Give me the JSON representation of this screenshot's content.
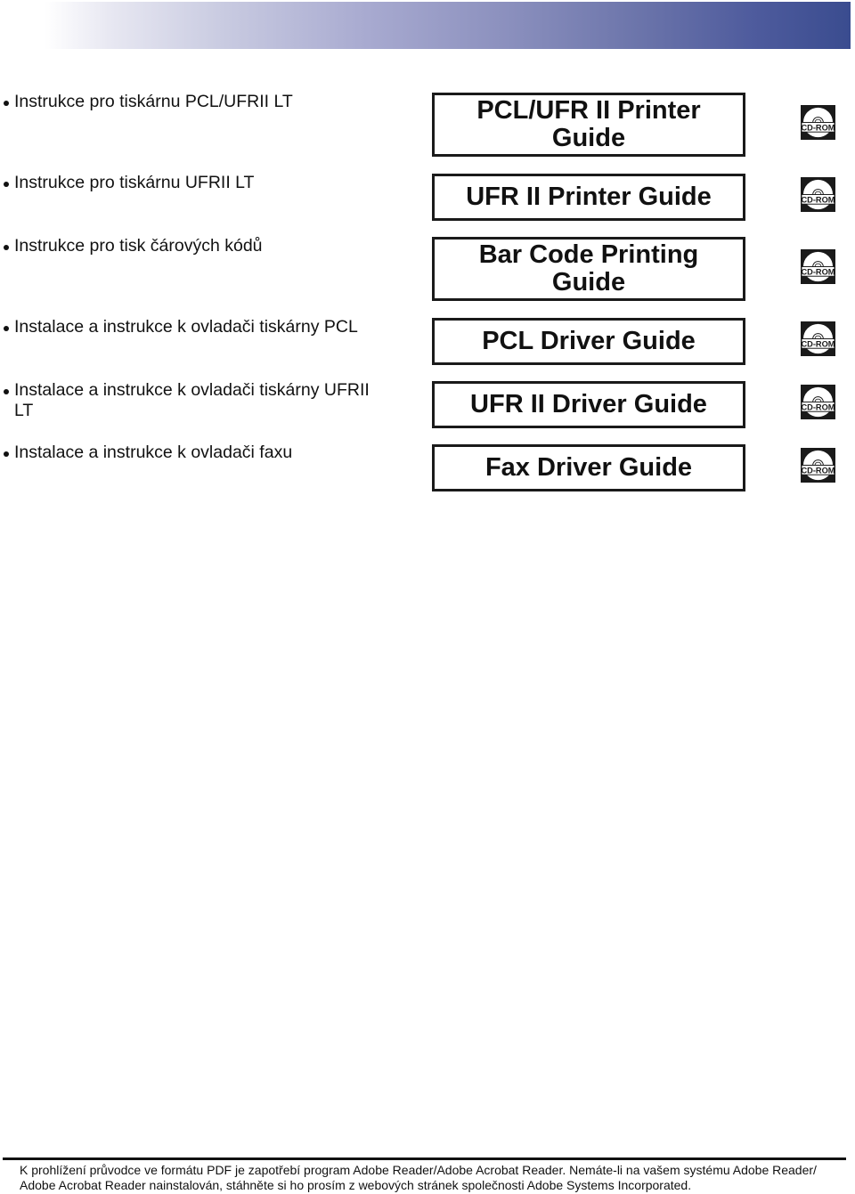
{
  "header": {
    "banner_colors": {
      "start": "#ffffff",
      "end": "#3a4c8f"
    }
  },
  "rows": [
    {
      "description": "Instrukce pro tiskárnu PCL/UFRII LT",
      "guide": "PCL/UFR II Printer Guide",
      "media_icon": "cd-rom-icon",
      "media_label": "CD-ROM"
    },
    {
      "description": "Instrukce pro tiskárnu UFRII LT",
      "guide": "UFR II Printer Guide",
      "media_icon": "cd-rom-icon",
      "media_label": "CD-ROM"
    },
    {
      "description": "Instrukce pro tisk čárových kódů",
      "guide": "Bar Code Printing Guide",
      "media_icon": "cd-rom-icon",
      "media_label": "CD-ROM"
    },
    {
      "description": "Instalace a instrukce k ovladači tiskárny PCL",
      "guide": "PCL Driver Guide",
      "media_icon": "cd-rom-icon",
      "media_label": "CD-ROM"
    },
    {
      "description": "Instalace a instrukce k ovladači tiskárny UFRII LT",
      "guide": "UFR II Driver Guide",
      "media_icon": "cd-rom-icon",
      "media_label": "CD-ROM"
    },
    {
      "description": "Instalace a instrukce k ovladači faxu",
      "guide": "Fax Driver Guide",
      "media_icon": "cd-rom-icon",
      "media_label": "CD-ROM"
    }
  ],
  "footer": {
    "note": "K prohlížení průvodce ve formátu PDF je zapotřebí program Adobe Reader/Adobe Acrobat Reader. Nemáte-li na vašem systému Adobe Reader/ Adobe Acrobat Reader nainstalován, stáhněte si ho prosím z webových stránek společnosti Adobe Systems Incorporated."
  }
}
